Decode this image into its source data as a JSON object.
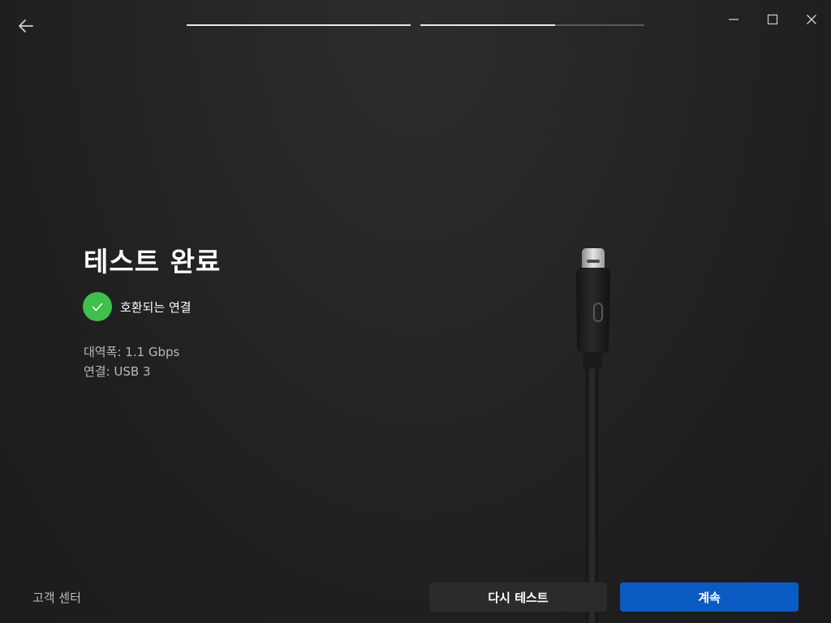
{
  "header": {
    "back_icon": "arrow-left-icon",
    "progress": [
      {
        "fraction": 1.0
      },
      {
        "fraction": 0.6
      }
    ],
    "window_controls": [
      "minimize-icon",
      "maximize-icon",
      "close-icon"
    ]
  },
  "main": {
    "title": "테스트 완료",
    "status": {
      "icon": "check-icon",
      "color": "#3fbf4b",
      "text": "호환되는 연결"
    },
    "details": [
      {
        "text": "대역폭: 1.1 Gbps"
      },
      {
        "text": "연결: USB 3"
      }
    ],
    "illustration": "usb-c-cable-icon"
  },
  "footer": {
    "support_label": "고객 센터",
    "retest_label": "다시 테스트",
    "continue_label": "계속",
    "accent_color": "#0a5bc4"
  }
}
